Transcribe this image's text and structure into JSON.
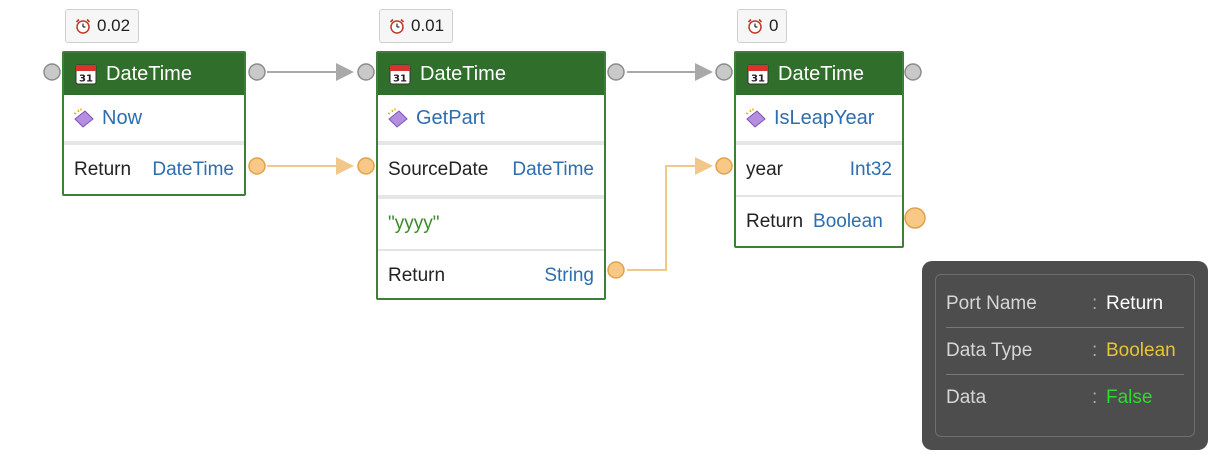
{
  "timers": [
    {
      "value": "0.02"
    },
    {
      "value": "0.01"
    },
    {
      "value": "0"
    }
  ],
  "nodes": [
    {
      "title": "DateTime",
      "method": "Now",
      "ports": [
        {
          "name": "Return",
          "type": "DateTime"
        }
      ]
    },
    {
      "title": "DateTime",
      "method": "GetPart",
      "ports": [
        {
          "name": "SourceDate",
          "type": "DateTime"
        },
        {
          "literal": "\"yyyy\""
        },
        {
          "name": "Return",
          "type": "String"
        }
      ]
    },
    {
      "title": "DateTime",
      "method": "IsLeapYear",
      "ports": [
        {
          "name": "year",
          "type": "Int32"
        },
        {
          "name": "Return",
          "type": "Boolean"
        }
      ]
    }
  ],
  "tooltip": {
    "rows": [
      {
        "label": "Port Name",
        "value": "Return"
      },
      {
        "label": "Data Type",
        "value": "Boolean"
      },
      {
        "label": "Data",
        "value": "False"
      }
    ]
  },
  "colors": {
    "header_green": "#2f6f2b",
    "type_blue": "#2d6db0",
    "data_port_orange": "#f5b65a",
    "exec_port_gray": "#c9c9c9"
  }
}
